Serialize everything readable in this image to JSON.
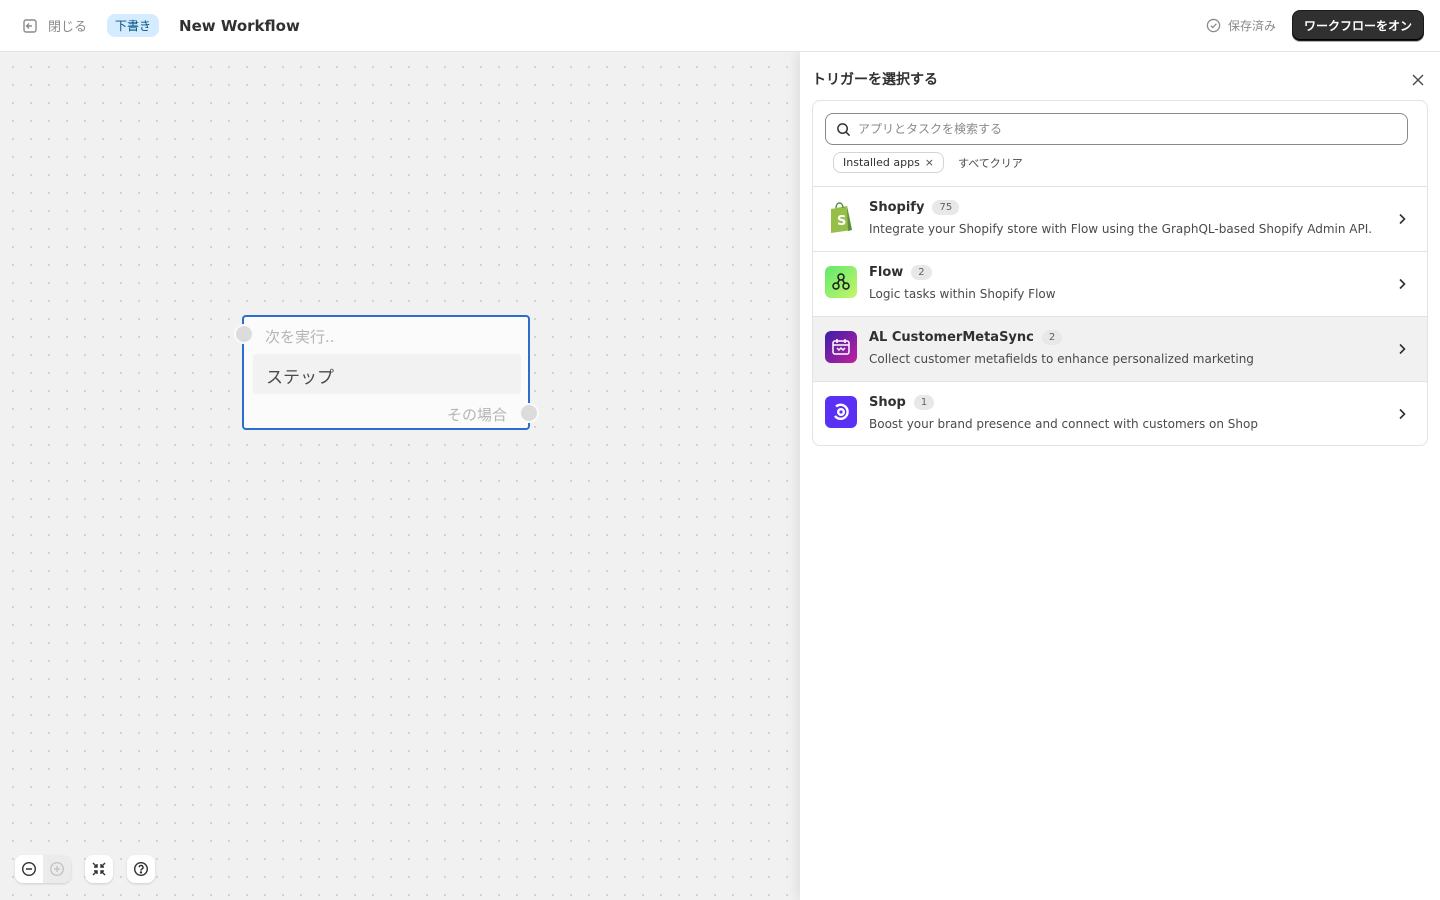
{
  "header": {
    "close_label": "閉じる",
    "status_badge": "下書き",
    "workflow_title": "New Workflow",
    "saved_label": "保存済み",
    "turn_on_label": "ワークフローをオン"
  },
  "canvas": {
    "step_node": {
      "pre_label": "次を実行..",
      "body_label": "ステップ",
      "post_label": "その場合"
    }
  },
  "panel": {
    "title": "トリガーを選択する",
    "search": {
      "placeholder": "アプリとタスクを検索する",
      "value": ""
    },
    "filter_chip": "Installed apps",
    "filter_chip_remove": "×",
    "clear_all": "すべてクリア",
    "apps": [
      {
        "name": "Shopify",
        "count": "75",
        "description": "Integrate your Shopify store with Flow using the GraphQL-based Shopify Admin API.",
        "icon": "shopify-bag-icon"
      },
      {
        "name": "Flow",
        "count": "2",
        "description": "Logic tasks within Shopify Flow",
        "icon": "flow-icon"
      },
      {
        "name": "AL CustomerMetaSync",
        "count": "2",
        "description": "Collect customer metafields to enhance personalized marketing",
        "icon": "customermetasync-icon"
      },
      {
        "name": "Shop",
        "count": "1",
        "description": "Boost your brand presence and connect with customers on Shop",
        "icon": "shop-icon"
      }
    ]
  },
  "colors": {
    "accent_dark": "#303030",
    "badge_bg": "#d5ebff",
    "node_border": "#2c6ecb",
    "shopify_green": "#95bf47",
    "shop_purple": "#5a31f4"
  }
}
